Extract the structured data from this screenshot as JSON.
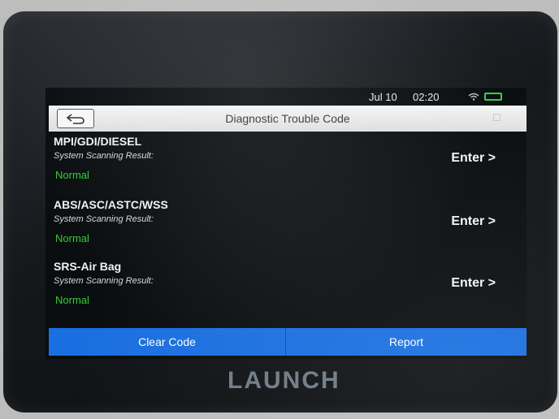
{
  "status": {
    "date": "Jul 10",
    "time": "02:20"
  },
  "header": {
    "title": "Diagnostic Trouble Code"
  },
  "systems": [
    {
      "name": "MPI/GDI/DIESEL",
      "subtitle": "System Scanning Result:",
      "status": "Normal",
      "action": "Enter >"
    },
    {
      "name": "ABS/ASC/ASTC/WSS",
      "subtitle": "System Scanning Result:",
      "status": "Normal",
      "action": "Enter >"
    },
    {
      "name": "SRS-Air Bag",
      "subtitle": "System Scanning Result:",
      "status": "Normal",
      "action": "Enter >"
    }
  ],
  "footer": {
    "clear_label": "Clear Code",
    "report_label": "Report"
  },
  "brand": {
    "logo_text": "LAUNCH"
  },
  "colors": {
    "accent": "#1a6fe0",
    "status_ok": "#2fd02f",
    "battery": "#35d04a"
  },
  "icons": {
    "back": "back-arrow-icon",
    "wifi": "wifi-icon",
    "battery": "battery-icon"
  }
}
